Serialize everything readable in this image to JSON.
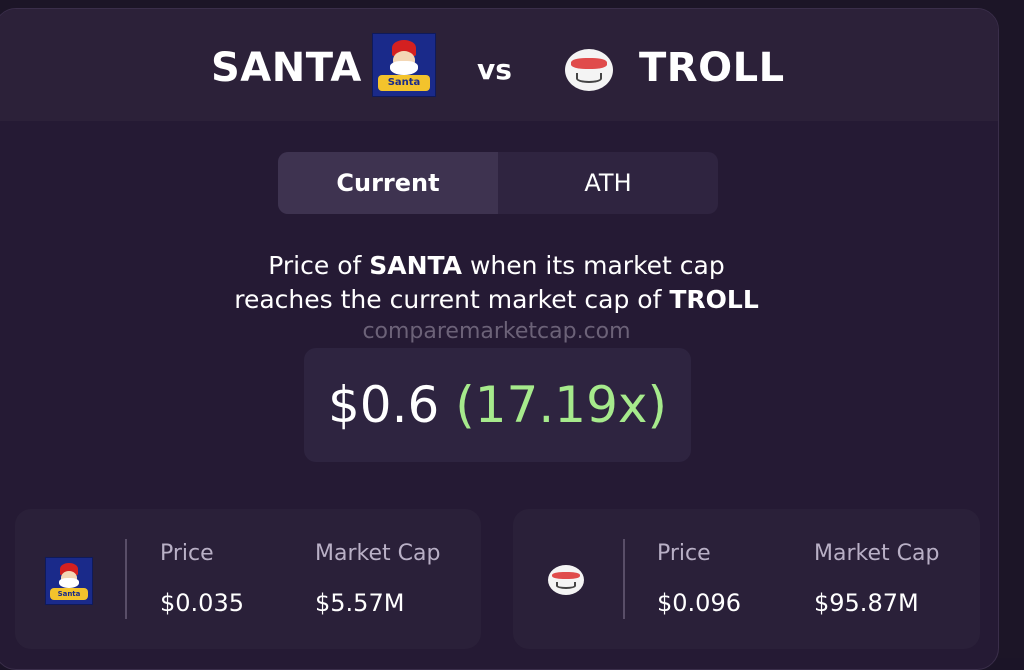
{
  "header": {
    "left_coin": "SANTA",
    "vs_label": "vs",
    "right_coin": "TROLL",
    "left_logo_text": "Santa",
    "left_logo_icon": "santa-logo-icon",
    "right_logo_icon": "troll-face-icon"
  },
  "tabs": [
    {
      "label": "Current",
      "active": true
    },
    {
      "label": "ATH",
      "active": false
    }
  ],
  "description": {
    "prefix": "Price of ",
    "coin_a": "SANTA",
    "middle": " when its market cap",
    "line2_prefix": "reaches the current market cap of ",
    "coin_b": "TROLL"
  },
  "watermark": "comparemarketcap.com",
  "result": {
    "price": "$0.6",
    "multiplier": "(17.19x)"
  },
  "stats": {
    "left": {
      "price_label": "Price",
      "price_value": "$0.035",
      "mcap_label": "Market Cap",
      "mcap_value": "$5.57M"
    },
    "right": {
      "price_label": "Price",
      "price_value": "$0.096",
      "mcap_label": "Market Cap",
      "mcap_value": "$95.87M"
    }
  },
  "colors": {
    "background": "#1c1527",
    "card": "#251a34",
    "accent_green": "#a6ea8c",
    "watermark": "#6c6278"
  }
}
